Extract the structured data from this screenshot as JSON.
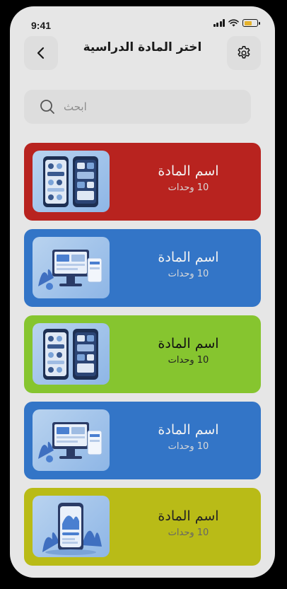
{
  "status_bar": {
    "time": "9:41"
  },
  "header": {
    "title": "اختر المادة الدراسية"
  },
  "search": {
    "placeholder": "ابحث"
  },
  "colors": {
    "red": "#b8231f",
    "blue": "#3375c7",
    "green": "#86c52f",
    "yellow": "#b9bb17"
  },
  "subjects": [
    {
      "name": "اسم المادة",
      "units": "10 وحدات",
      "color": "#b8231f",
      "image": "phones-app-illustration"
    },
    {
      "name": "اسم المادة",
      "units": "10 وحدات",
      "color": "#3375c7",
      "image": "desktop-dashboard-illustration"
    },
    {
      "name": "اسم المادة",
      "units": "10 وحدات",
      "color": "#86c52f",
      "image": "phones-app-illustration"
    },
    {
      "name": "اسم المادة",
      "units": "10 وحدات",
      "color": "#3375c7",
      "image": "desktop-dashboard-illustration"
    },
    {
      "name": "اسم المادة",
      "units": "10 وحدات",
      "color": "#b9bb17",
      "image": "mobile-plants-illustration"
    }
  ]
}
